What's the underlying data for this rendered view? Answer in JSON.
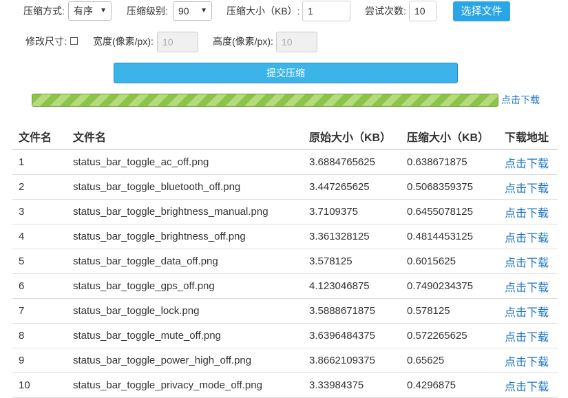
{
  "controls": {
    "method_label": "压缩方式:",
    "method_value": "有序",
    "level_label": "压缩级别:",
    "level_value": "90",
    "size_label": "压缩大小（KB）:",
    "size_value": "1",
    "attempts_label": "尝试次数:",
    "attempts_value": "10",
    "choose_file_label": "选择文件",
    "resize_label": "修改尺寸:",
    "width_label": "宽度(像素/px):",
    "width_placeholder": "10",
    "height_label": "高度(像素/px):",
    "height_placeholder": "10",
    "submit_label": "提交压缩",
    "progress_percent": 100,
    "download_all_label": "点击下载"
  },
  "colors": {
    "button_blue": "#2aa6e6",
    "progress_green": "#8dc34a",
    "link_blue": "#1b74c5"
  },
  "table": {
    "headers": [
      "文件名",
      "文件名",
      "原始大小（KB）",
      "压缩大小（KB）",
      "下载地址"
    ],
    "rows": [
      {
        "index": "1",
        "name": "status_bar_toggle_ac_off.png",
        "original": "3.6884765625",
        "compressed": "0.638671875",
        "download": "点击下载"
      },
      {
        "index": "2",
        "name": "status_bar_toggle_bluetooth_off.png",
        "original": "3.447265625",
        "compressed": "0.5068359375",
        "download": "点击下载"
      },
      {
        "index": "3",
        "name": "status_bar_toggle_brightness_manual.png",
        "original": "3.7109375",
        "compressed": "0.6455078125",
        "download": "点击下载"
      },
      {
        "index": "4",
        "name": "status_bar_toggle_brightness_off.png",
        "original": "3.361328125",
        "compressed": "0.4814453125",
        "download": "点击下载"
      },
      {
        "index": "5",
        "name": "status_bar_toggle_data_off.png",
        "original": "3.578125",
        "compressed": "0.6015625",
        "download": "点击下载"
      },
      {
        "index": "6",
        "name": "status_bar_toggle_gps_off.png",
        "original": "4.123046875",
        "compressed": "0.7490234375",
        "download": "点击下载"
      },
      {
        "index": "7",
        "name": "status_bar_toggle_lock.png",
        "original": "3.5888671875",
        "compressed": "0.578125",
        "download": "点击下载"
      },
      {
        "index": "8",
        "name": "status_bar_toggle_mute_off.png",
        "original": "3.6396484375",
        "compressed": "0.572265625",
        "download": "点击下载"
      },
      {
        "index": "9",
        "name": "status_bar_toggle_power_high_off.png",
        "original": "3.8662109375",
        "compressed": "0.65625",
        "download": "点击下载"
      },
      {
        "index": "10",
        "name": "status_bar_toggle_privacy_mode_off.png",
        "original": "3.33984375",
        "compressed": "0.4296875",
        "download": "点击下载"
      }
    ]
  }
}
